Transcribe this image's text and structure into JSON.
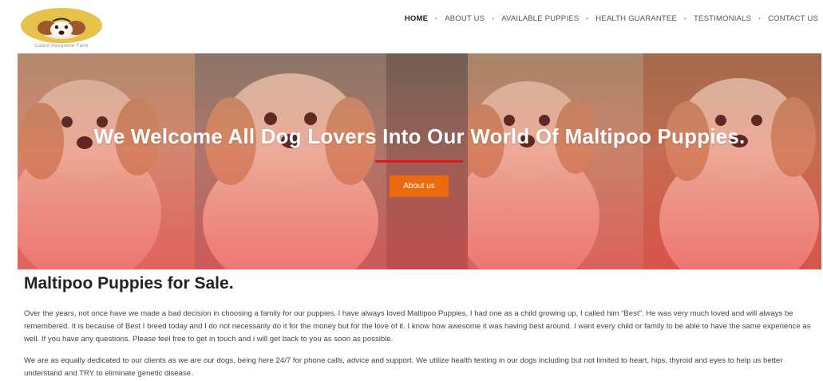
{
  "logo": {
    "icon": "dog-face-icon",
    "subtitle": "Cutest Havanese Farm",
    "color": "#e6c24a"
  },
  "nav": {
    "items": [
      {
        "label": "HOME",
        "active": true
      },
      {
        "label": "ABOUT US"
      },
      {
        "label": "AVAILABLE PUPPIES"
      },
      {
        "label": "HEALTH GUARANTEE"
      },
      {
        "label": "TESTIMONIALS"
      },
      {
        "label": "CONTACT US"
      }
    ],
    "separator": "•"
  },
  "hero": {
    "title": "We Welcome All Dog Lovers Into Our World Of Maltipoo Puppies.",
    "button_label": "About us",
    "accent_line_color": "#e11919",
    "button_color": "#ec6a0c"
  },
  "main": {
    "section_title": "Maltipoo Puppies for Sale.",
    "paragraph_1": "Over the years, not once have we made a bad decision in choosing a family for our puppies. I have always loved Maltipoo Puppies, I had one as a child growing up, I called him “Best”. He was very much loved and will always be remembered. It is because of Best I breed today and I do not necessarily do it for the money but for the love of it. I know how awesome it was having best around. I want every child or family to be able to have the same experience as well. If you have any questions. Please feel free to get in touch and i will get back to you as soon as possible.",
    "paragraph_2": "We are as equally dedicated to our clients as we are our dogs, being here 24/7 for phone calls, advice and support. We utilize health testing in our dogs including but not limited to heart, hips, thyroid and eyes to help us better understand and TRY to eliminate genetic disease."
  }
}
